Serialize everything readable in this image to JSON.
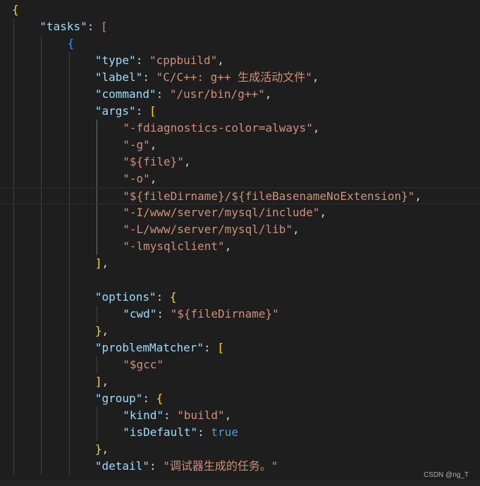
{
  "editor": {
    "lines": [
      {
        "indent": 0,
        "tokens": [
          {
            "t": "{",
            "c": "b1"
          }
        ]
      },
      {
        "indent": 1,
        "tokens": [
          {
            "t": "\"tasks\"",
            "c": "k"
          },
          {
            "t": ": ",
            "c": "p"
          },
          {
            "t": "[",
            "c": "b2"
          }
        ]
      },
      {
        "indent": 2,
        "tokens": [
          {
            "t": "{",
            "c": "b3"
          }
        ]
      },
      {
        "indent": 3,
        "tokens": [
          {
            "t": "\"type\"",
            "c": "k"
          },
          {
            "t": ": ",
            "c": "p"
          },
          {
            "t": "\"cppbuild\"",
            "c": "s"
          },
          {
            "t": ",",
            "c": "p"
          }
        ]
      },
      {
        "indent": 3,
        "tokens": [
          {
            "t": "\"label\"",
            "c": "k"
          },
          {
            "t": ": ",
            "c": "p"
          },
          {
            "t": "\"C/C++: g++ 生成活动文件\"",
            "c": "s"
          },
          {
            "t": ",",
            "c": "p"
          }
        ]
      },
      {
        "indent": 3,
        "tokens": [
          {
            "t": "\"command\"",
            "c": "k"
          },
          {
            "t": ": ",
            "c": "p"
          },
          {
            "t": "\"/usr/bin/g++\"",
            "c": "s"
          },
          {
            "t": ",",
            "c": "p"
          }
        ]
      },
      {
        "indent": 3,
        "tokens": [
          {
            "t": "\"args\"",
            "c": "k"
          },
          {
            "t": ": ",
            "c": "p"
          },
          {
            "t": "[",
            "c": "b1"
          }
        ]
      },
      {
        "indent": 4,
        "tokens": [
          {
            "t": "\"-fdiagnostics-color=always\"",
            "c": "s"
          },
          {
            "t": ",",
            "c": "p"
          }
        ]
      },
      {
        "indent": 4,
        "tokens": [
          {
            "t": "\"-g\"",
            "c": "s"
          },
          {
            "t": ",",
            "c": "p"
          }
        ]
      },
      {
        "indent": 4,
        "tokens": [
          {
            "t": "\"${file}\"",
            "c": "s"
          },
          {
            "t": ",",
            "c": "p"
          }
        ]
      },
      {
        "indent": 4,
        "tokens": [
          {
            "t": "\"-o\"",
            "c": "s"
          },
          {
            "t": ",",
            "c": "p"
          }
        ]
      },
      {
        "indent": 4,
        "current": true,
        "tokens": [
          {
            "t": "\"${fileDirname}/${fileBasenameNoExtension}\"",
            "c": "s"
          },
          {
            "t": ",",
            "c": "p"
          }
        ]
      },
      {
        "indent": 4,
        "tokens": [
          {
            "t": "\"-I/www/server/mysql/include\"",
            "c": "s"
          },
          {
            "t": ",",
            "c": "p"
          }
        ]
      },
      {
        "indent": 4,
        "tokens": [
          {
            "t": "\"-L/www/server/mysql/lib\"",
            "c": "s"
          },
          {
            "t": ",",
            "c": "p"
          }
        ]
      },
      {
        "indent": 4,
        "tokens": [
          {
            "t": "\"-lmysqlclient\"",
            "c": "s"
          },
          {
            "t": ",",
            "c": "p"
          }
        ]
      },
      {
        "indent": 3,
        "tokens": [
          {
            "t": "]",
            "c": "b1"
          },
          {
            "t": ",",
            "c": "p"
          }
        ]
      },
      {
        "indent": 0,
        "tokens": []
      },
      {
        "indent": 3,
        "tokens": [
          {
            "t": "\"options\"",
            "c": "k"
          },
          {
            "t": ": ",
            "c": "p"
          },
          {
            "t": "{",
            "c": "b1"
          }
        ]
      },
      {
        "indent": 4,
        "tokens": [
          {
            "t": "\"cwd\"",
            "c": "k"
          },
          {
            "t": ": ",
            "c": "p"
          },
          {
            "t": "\"${fileDirname}\"",
            "c": "s"
          }
        ]
      },
      {
        "indent": 3,
        "tokens": [
          {
            "t": "}",
            "c": "b1"
          },
          {
            "t": ",",
            "c": "p"
          }
        ]
      },
      {
        "indent": 3,
        "tokens": [
          {
            "t": "\"problemMatcher\"",
            "c": "k"
          },
          {
            "t": ": ",
            "c": "p"
          },
          {
            "t": "[",
            "c": "b1"
          }
        ]
      },
      {
        "indent": 4,
        "tokens": [
          {
            "t": "\"$gcc\"",
            "c": "s"
          }
        ]
      },
      {
        "indent": 3,
        "tokens": [
          {
            "t": "]",
            "c": "b1"
          },
          {
            "t": ",",
            "c": "p"
          }
        ]
      },
      {
        "indent": 3,
        "tokens": [
          {
            "t": "\"group\"",
            "c": "k"
          },
          {
            "t": ": ",
            "c": "p"
          },
          {
            "t": "{",
            "c": "b1"
          }
        ]
      },
      {
        "indent": 4,
        "tokens": [
          {
            "t": "\"kind\"",
            "c": "k"
          },
          {
            "t": ": ",
            "c": "p"
          },
          {
            "t": "\"build\"",
            "c": "s"
          },
          {
            "t": ",",
            "c": "p"
          }
        ]
      },
      {
        "indent": 4,
        "tokens": [
          {
            "t": "\"isDefault\"",
            "c": "k"
          },
          {
            "t": ": ",
            "c": "p"
          },
          {
            "t": "true",
            "c": "kw"
          }
        ]
      },
      {
        "indent": 3,
        "tokens": [
          {
            "t": "}",
            "c": "b1"
          },
          {
            "t": ",",
            "c": "p"
          }
        ]
      },
      {
        "indent": 3,
        "tokens": [
          {
            "t": "\"detail\"",
            "c": "k"
          },
          {
            "t": ": ",
            "c": "p"
          },
          {
            "t": "\"调试器生成的任务。\"",
            "c": "s"
          }
        ]
      }
    ]
  },
  "watermark": "CSDN @ng_T",
  "colors": {
    "background": "#1e1e1e",
    "key": "#9cdcfe",
    "string": "#ce9178",
    "bracket_gold": "#ffd700",
    "bracket_purple": "#da70d6",
    "bracket_blue": "#179fff",
    "keyword": "#569cd6"
  }
}
